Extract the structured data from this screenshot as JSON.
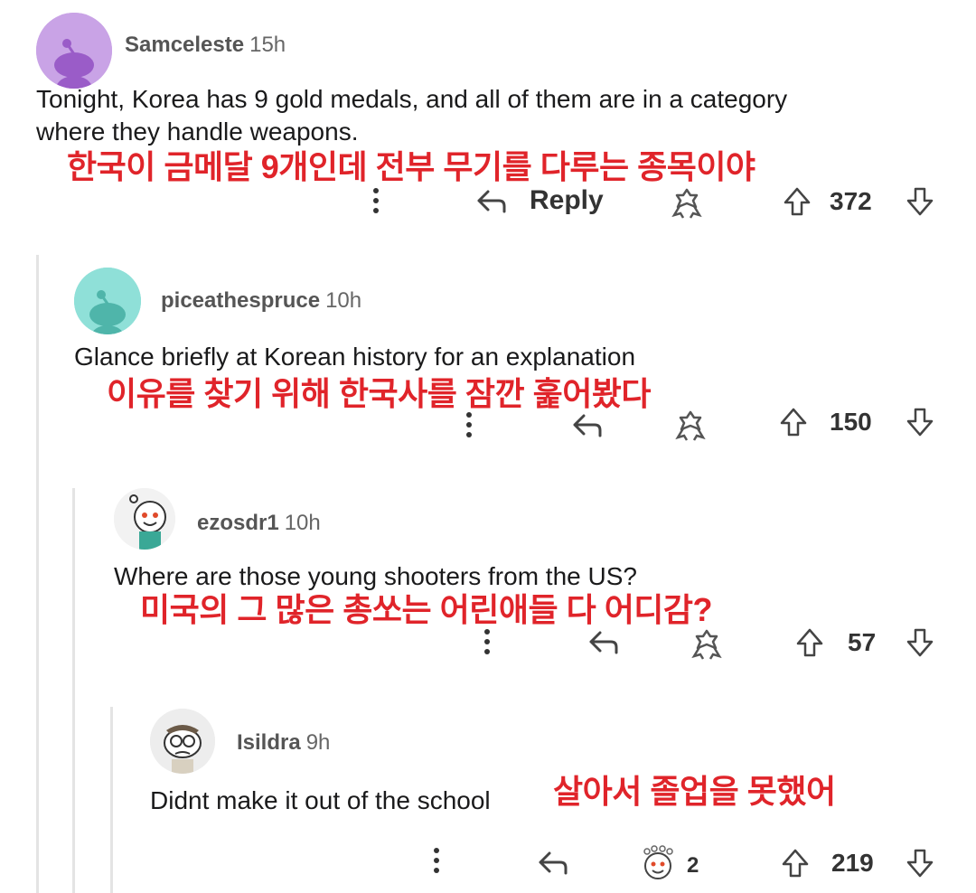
{
  "comments": [
    {
      "username": "Samceleste",
      "time": "15h",
      "body_line1": "Tonight, Korea has 9 gold medals, and all of them are in a category",
      "body_line2": "where they handle weapons.",
      "translation": "한국이 금메달 9개인데 전부 무기를 다루는 종목이야",
      "reply_label": "Reply",
      "score": "372",
      "avatar_color": "#c9a3e6"
    },
    {
      "username": "piceathespruce",
      "time": "10h",
      "body_line1": "Glance briefly at Korean history for an explanation",
      "translation": "이유를 찾기 위해 한국사를 잠깐 훑어봤다",
      "score": "150",
      "avatar_color": "#8fe0d8"
    },
    {
      "username": "ezosdr1",
      "time": "10h",
      "body_line1": "Where are those young shooters from the US?",
      "translation": "미국의 그 많은 총쏘는 어린애들 다 어디감?",
      "score": "57"
    },
    {
      "username": "Isildra",
      "time": "9h",
      "body_line1": "Didnt make it out of the school",
      "translation": "살아서 졸업을 못했어",
      "award_count": "2",
      "score": "219"
    }
  ],
  "icons": {
    "more": "more-vertical-icon",
    "reply": "reply-arrow-icon",
    "award": "award-icon",
    "upvote": "upvote-arrow-icon",
    "downvote": "downvote-arrow-icon"
  },
  "colors": {
    "translation": "#e0242a",
    "thread_line": "#e4e4e4"
  }
}
